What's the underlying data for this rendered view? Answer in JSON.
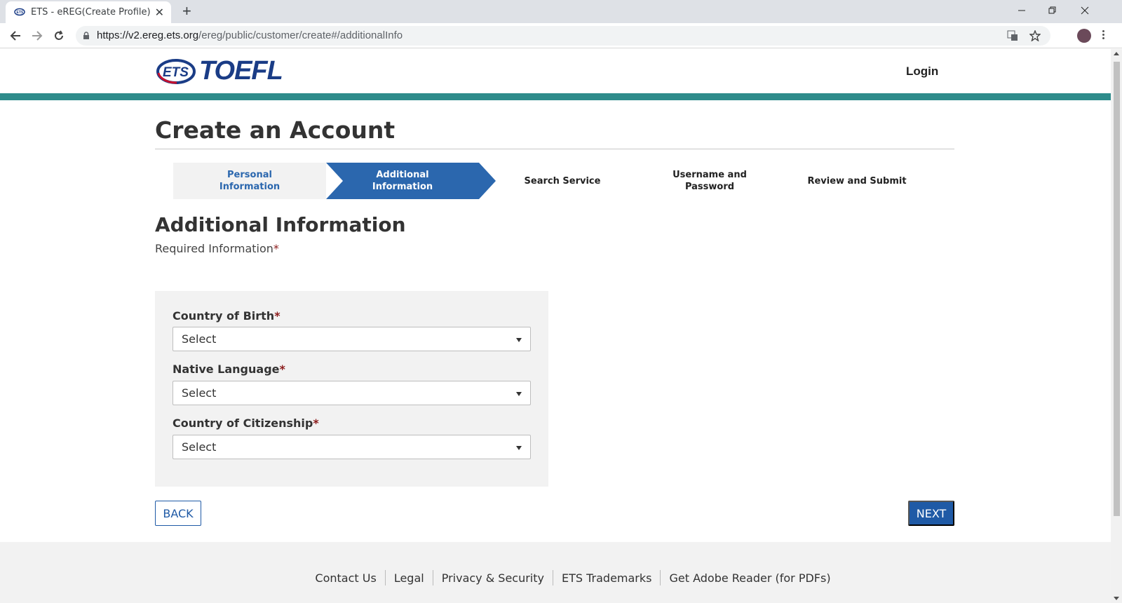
{
  "browser": {
    "tab_title": "ETS - eREG(Create Profile)",
    "url_host": "https://v2.ereg.ets.org",
    "url_path": "/ereg/public/customer/create#/additionalInfo"
  },
  "header": {
    "logo_badge": "ETS",
    "logo_word": "TOEFL",
    "login_label": "Login",
    "accent_color": "#2e8c8b"
  },
  "page": {
    "title": "Create an Account"
  },
  "steps": [
    {
      "label": "Personal\nInformation",
      "state": "completed"
    },
    {
      "label": "Additional\nInformation",
      "state": "current"
    },
    {
      "label": "Search Service",
      "state": "upcoming"
    },
    {
      "label": "Username and\nPassword",
      "state": "upcoming"
    },
    {
      "label": "Review and Submit",
      "state": "upcoming"
    }
  ],
  "section": {
    "title": "Additional Information",
    "required_note": "Required Information",
    "required_marker": "*"
  },
  "form": {
    "fields": [
      {
        "label": "Country of Birth",
        "value": "Select"
      },
      {
        "label": "Native Language",
        "value": "Select"
      },
      {
        "label": "Country of Citizenship",
        "value": "Select"
      }
    ]
  },
  "actions": {
    "back_label": "BACK",
    "next_label": "NEXT"
  },
  "footer": {
    "links": [
      "Contact Us",
      "Legal",
      "Privacy & Security",
      "ETS Trademarks",
      "Get Adobe Reader (for PDFs)"
    ]
  }
}
